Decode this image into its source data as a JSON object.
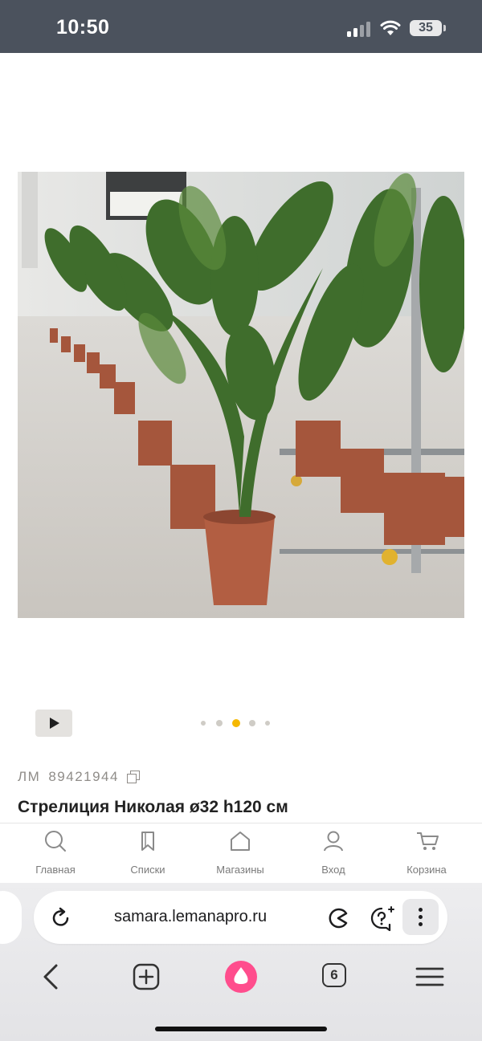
{
  "status_bar": {
    "time": "10:50",
    "battery": "35",
    "icons": [
      "signal-icon",
      "wifi-icon",
      "battery-icon"
    ]
  },
  "product": {
    "image_alt": "Стрелиция Николая",
    "gallery": {
      "count": 5,
      "active_index": 2
    },
    "sku_label": "ЛМ",
    "sku_number": "89421944",
    "title": "Стрелиция Николая ø32 h120 см"
  },
  "site_nav": {
    "items": [
      {
        "label": "Главная",
        "icon": "search-icon"
      },
      {
        "label": "Списки",
        "icon": "bookmark-icon"
      },
      {
        "label": "Магазины",
        "icon": "house-icon"
      },
      {
        "label": "Вход",
        "icon": "user-icon"
      },
      {
        "label": "Корзина",
        "icon": "cart-icon"
      }
    ]
  },
  "browser": {
    "url": "samara.lemanapro.ru",
    "tabs_count": "6"
  },
  "colors": {
    "status_bar": "#4b525d",
    "accent_dot": "#f5b800",
    "alice": "#ff4d8d"
  }
}
